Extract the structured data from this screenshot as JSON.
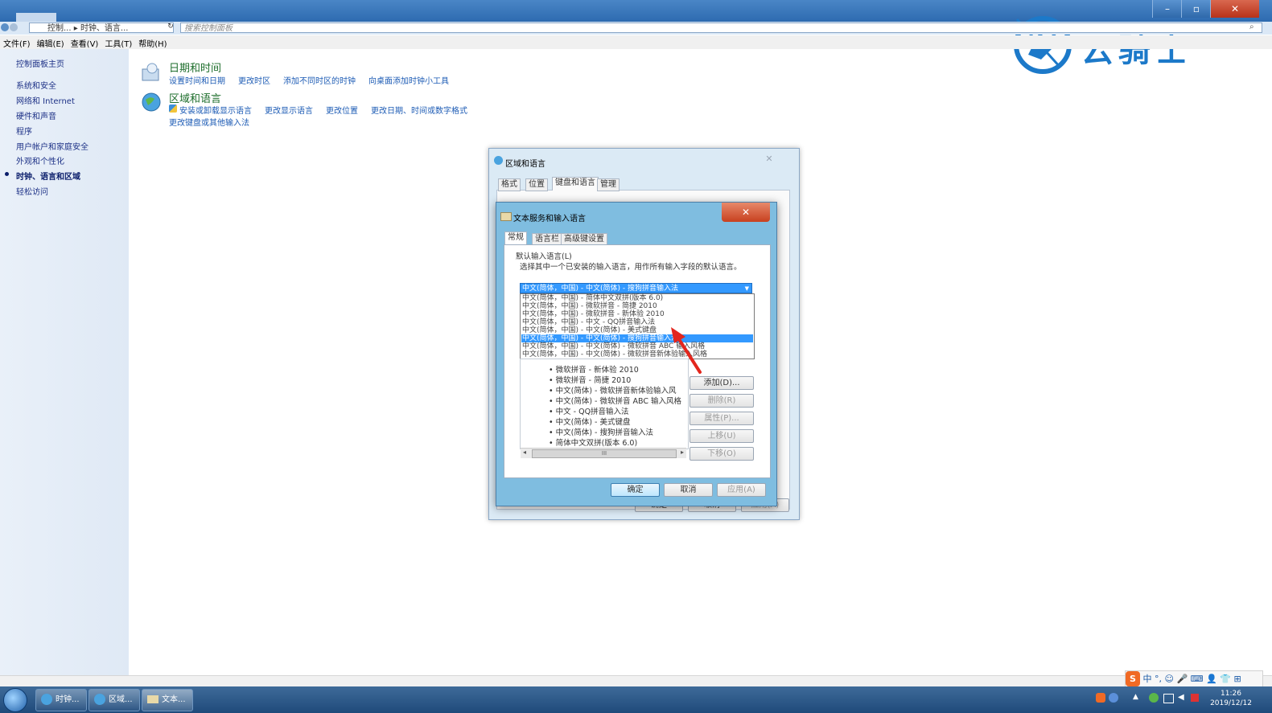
{
  "window": {
    "breadcrumb": [
      "控制...",
      "时钟、语言..."
    ],
    "search_placeholder": "搜索控制面板",
    "controls": {
      "minimize": "–",
      "restore": "▫",
      "close": "✕"
    }
  },
  "menu": [
    "文件(F)",
    "编辑(E)",
    "查看(V)",
    "工具(T)",
    "帮助(H)"
  ],
  "watermark": {
    "text": "云骑士"
  },
  "sidebar": {
    "home": "控制面板主页",
    "items": [
      "系统和安全",
      "网络和 Internet",
      "硬件和声音",
      "程序",
      "用户帐户和家庭安全",
      "外观和个性化",
      "时钟、语言和区域",
      "轻松访问"
    ],
    "active_index": 6
  },
  "sections": [
    {
      "title": "日期和时间",
      "links": [
        "设置时间和日期",
        "更改时区",
        "添加不同时区的时钟",
        "向桌面添加时钟小工具"
      ]
    },
    {
      "title": "区域和语言",
      "links": [
        "安装或卸载显示语言",
        "更改显示语言",
        "更改位置",
        "更改日期、时间或数字格式",
        "更改键盘或其他输入法"
      ]
    }
  ],
  "region_dialog": {
    "title": "区域和语言",
    "close": "✕",
    "tabs": [
      "格式",
      "位置",
      "键盘和语言",
      "管理"
    ],
    "bottom_buttons": [
      "确定",
      "取消",
      "应用(A)"
    ]
  },
  "text_dialog": {
    "title": "文本服务和输入语言",
    "close": "✕",
    "tabs": [
      "常规",
      "语言栏",
      "高级键设置"
    ],
    "group_label": "默认输入语言(L)",
    "description": "选择其中一个已安装的输入语言，用作所有输入字段的默认语言。",
    "combo_value": "中文(简体，中国) - 中文(简体) - 搜狗拼音输入法",
    "dropdown_items": [
      "中文(简体，中国) - 简体中文双拼(版本 6.0)",
      "中文(简体，中国) - 微软拼音 - 简捷 2010",
      "中文(简体，中国) - 微软拼音 - 新体验 2010",
      "中文(简体，中国) - 中文 - QQ拼音输入法",
      "中文(简体，中国) - 中文(简体) - 美式键盘",
      "中文(简体，中国) - 中文(简体) - 搜狗拼音输入法",
      "中文(简体，中国) - 中文(简体) - 微软拼音 ABC 输入风格",
      "中文(简体，中国) - 中文(简体) - 微软拼音新体验输入风格"
    ],
    "dropdown_selected_index": 5,
    "installed_services": [
      "微软拼音 - 新体验 2010",
      "微软拼音 - 简捷 2010",
      "中文(简体) - 微软拼音新体验输入风",
      "中文(简体) - 微软拼音 ABC 输入风格",
      "中文 - QQ拼音输入法",
      "中文(简体) - 美式键盘",
      "中文(简体) - 搜狗拼音输入法",
      "简体中文双拼(版本 6.0)"
    ],
    "side_buttons": [
      "添加(D)...",
      "删除(R)",
      "属性(P)...",
      "上移(U)",
      "下移(O)"
    ],
    "scroll_thumb": "III",
    "bottom_buttons": [
      "确定",
      "取消",
      "应用(A)"
    ]
  },
  "taskbar": {
    "items": [
      "时钟...",
      "区域...",
      "文本..."
    ],
    "tray_ime": [
      "S",
      "中",
      "°,",
      "☺",
      "🎤",
      "⌨",
      "👤",
      "👕",
      "⊞"
    ],
    "clock_time": "11:26",
    "clock_date": "2019/12/12"
  },
  "colors": {
    "accent": "#3399ff",
    "title_bar": "#2d6bb0",
    "link": "#1e5cb5",
    "section_title": "#1e6e2c"
  }
}
